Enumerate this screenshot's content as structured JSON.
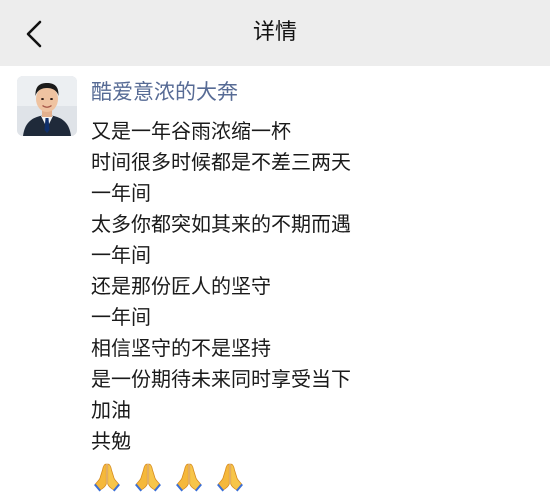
{
  "nav": {
    "title": "详情",
    "back_icon": "chevron-left-icon"
  },
  "post": {
    "author": "酷爱意浓的大奔",
    "lines": [
      "又是一年谷雨浓缩一杯",
      "时间很多时候都是不差三两天",
      "一年间",
      "太多你都突如其来的不期而遇",
      "一年间",
      "还是那份匠人的坚守",
      "一年间",
      "相信坚守的不是坚持",
      "是一份期待未来同时享受当下",
      "加油",
      "共勉"
    ],
    "emoji_icon": "folded-hands-emoji",
    "emoji_count": 4
  },
  "colors": {
    "nav_bg": "#ededed",
    "author_link": "#576b95",
    "text": "#1a1a1a"
  }
}
